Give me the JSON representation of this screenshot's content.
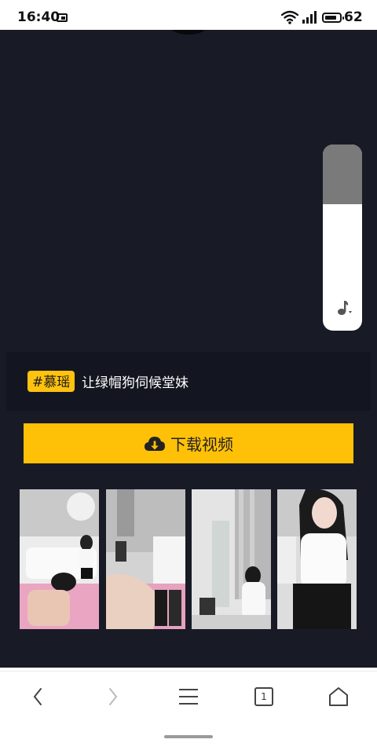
{
  "status_bar": {
    "time": "16:40",
    "battery": "62",
    "icons": [
      "gallery-notif-icon",
      "wifi-icon",
      "signal-icon",
      "battery-icon"
    ]
  },
  "player": {
    "volume_level_percent": 68,
    "volume_icon": "music-note-icon"
  },
  "caption": {
    "hashtag": "#慕瑶",
    "title": "让绿帽狗伺候堂妹"
  },
  "download_button": {
    "label": "下载视频",
    "icon": "cloud-download-icon"
  },
  "thumbnails": [
    {
      "name": "thumbnail-1"
    },
    {
      "name": "thumbnail-2"
    },
    {
      "name": "thumbnail-3"
    },
    {
      "name": "thumbnail-4"
    }
  ],
  "nav": {
    "tab_count": "1",
    "icons": [
      "back-arrow-icon",
      "forward-arrow-icon",
      "menu-icon",
      "tabs-icon",
      "home-icon"
    ]
  },
  "colors": {
    "page_bg": "#181b26",
    "accent": "#ffc107",
    "caption_bg": "#131621"
  }
}
